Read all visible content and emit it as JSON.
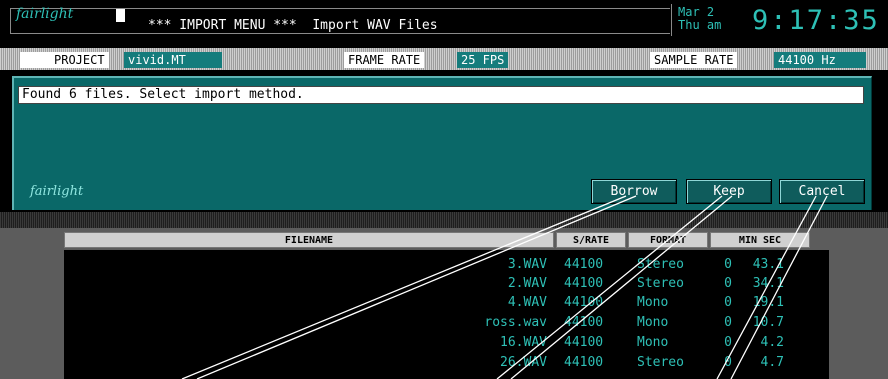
{
  "header": {
    "logo": "fairlight",
    "menu_title": "*** IMPORT MENU ***  Import WAV Files",
    "date_line1": "Mar 2",
    "date_line2": "Thu am",
    "clock": "9:17:35"
  },
  "info_bar": {
    "project_label": "PROJECT",
    "project_value": "vivid.MT",
    "frame_rate_label": "FRAME RATE",
    "frame_rate_value": "25 FPS",
    "sample_rate_label": "SAMPLE RATE",
    "sample_rate_value": "44100 Hz"
  },
  "dialog": {
    "message": "Found 6 files.  Select import method.",
    "logo": "fairlight",
    "buttons": {
      "borrow": "Borrow",
      "keep": "Keep",
      "cancel": "Cancel"
    }
  },
  "file_table": {
    "headers": {
      "filename": "FILENAME",
      "srate": "S/RATE",
      "format": "FORMAT",
      "minsec": "MIN SEC"
    },
    "rows": [
      {
        "filename": "3.WAV",
        "srate": "44100",
        "format": "Stereo",
        "min": "0",
        "sec": "43.1"
      },
      {
        "filename": "2.WAV",
        "srate": "44100",
        "format": "Stereo",
        "min": "0",
        "sec": "34.1"
      },
      {
        "filename": "4.WAV",
        "srate": "44100",
        "format": "Mono",
        "min": "0",
        "sec": "19.1"
      },
      {
        "filename": "ross.wav",
        "srate": "44100",
        "format": "Mono",
        "min": "0",
        "sec": "10.7"
      },
      {
        "filename": "16.WAV",
        "srate": "44100",
        "format": "Mono",
        "min": "0",
        "sec": "4.2"
      },
      {
        "filename": "26.WAV",
        "srate": "44100",
        "format": "Stereo",
        "min": "0",
        "sec": "4.7"
      }
    ]
  },
  "colors": {
    "accent_teal": "#2ec0b6",
    "dialog_bg": "#0a6868",
    "value_bg": "#157c7c"
  }
}
